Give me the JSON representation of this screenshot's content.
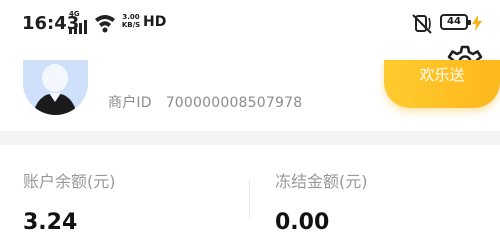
{
  "status_bar": {
    "time": "16:43",
    "network_label": "4G",
    "speed_value": "3.00",
    "speed_unit": "KB/S",
    "hd_label": "HD",
    "battery_level": "44",
    "icons": [
      "signal-4g-icon",
      "wifi-icon",
      "mute-icon",
      "battery-icon",
      "charging-icon"
    ]
  },
  "header": {
    "settings_icon": "gear-icon"
  },
  "profile": {
    "avatar_icon": "avatar",
    "merchant_id_label": "商户ID",
    "merchant_id_value": "700000008507978",
    "promo_button_label": "欢乐送"
  },
  "balances": {
    "account_balance_label": "账户余额(元)",
    "account_balance_value": "3.24",
    "frozen_amount_label": "冻结金额(元)",
    "frozen_amount_value": "0.00"
  },
  "colors": {
    "accent": "#fdb81c",
    "label_gray": "#999999",
    "band_gray": "#f3f3f3"
  }
}
